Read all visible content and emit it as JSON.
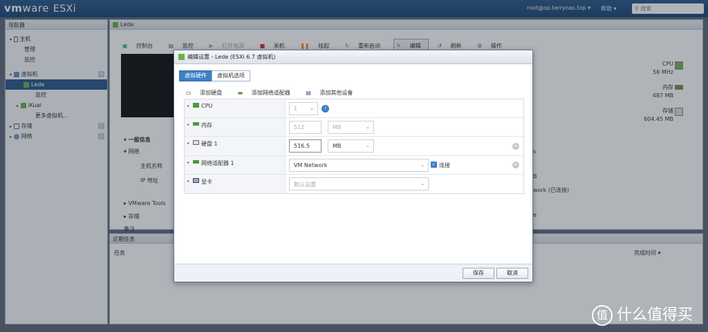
{
  "header": {
    "logo_vm": "vm",
    "logo_ware": "ware",
    "logo_product": "ESXi",
    "user": "root@op.terrynas.top ▾",
    "help": "帮助 ▾",
    "search_placeholder": "搜索"
  },
  "navigator": {
    "title": "导航器",
    "items": [
      {
        "label": "主机"
      },
      {
        "label": "管理"
      },
      {
        "label": "监控"
      },
      {
        "label": "虚拟机",
        "badge": "4"
      },
      {
        "label": "Lede"
      },
      {
        "label": "监控"
      },
      {
        "label": "iKuai"
      },
      {
        "label": "更多虚拟机..."
      },
      {
        "label": "存储",
        "badge": "1"
      },
      {
        "label": "网络",
        "badge": "2"
      }
    ]
  },
  "main": {
    "title": "Lede",
    "toolbar": [
      "控制台",
      "监控",
      "打开电源",
      "关机",
      "挂起",
      "重新启动",
      "编辑",
      "刷新",
      "操作"
    ],
    "resources": [
      {
        "name": "CPU",
        "value": "56 MHz"
      },
      {
        "name": "内存",
        "value": "487 MB"
      },
      {
        "name": "存储",
        "value": "604.45 MB"
      }
    ],
    "general_info": "一般信息",
    "network": "网络",
    "host_name": "主机名称",
    "ip_address": "IP 地址",
    "vmware_tools": "VMware Tools",
    "storage": "存储",
    "notes": "备注",
    "right_b": "B",
    "right_network": "work (已连接)",
    "right_s": "s",
    "right_e": "e"
  },
  "tasks": {
    "title": "近期任务",
    "col_task": "任务",
    "col_completed": "完成时间 ▾"
  },
  "watermark": {
    "text": "什么值得买",
    "icon": "值"
  },
  "dialog": {
    "title": "编辑设置 - Lede (ESXi 6.7 虚拟机)",
    "tabs": [
      "虚拟硬件",
      "虚拟机选项"
    ],
    "add_disk": "添加硬盘",
    "add_nic": "添加网络适配器",
    "add_other": "添加其他设备",
    "rows": {
      "cpu": {
        "label": "CPU",
        "value": "1"
      },
      "memory": {
        "label": "内存",
        "value": "512",
        "unit": "MB"
      },
      "disk": {
        "label": "硬盘 1",
        "value": "516.5",
        "unit": "MB"
      },
      "nic": {
        "label": "网络适配器 1",
        "value": "VM Network",
        "connect": "连接"
      },
      "video": {
        "label": "显卡",
        "value": "默认设置"
      }
    },
    "save": "保存",
    "cancel": "取消"
  }
}
